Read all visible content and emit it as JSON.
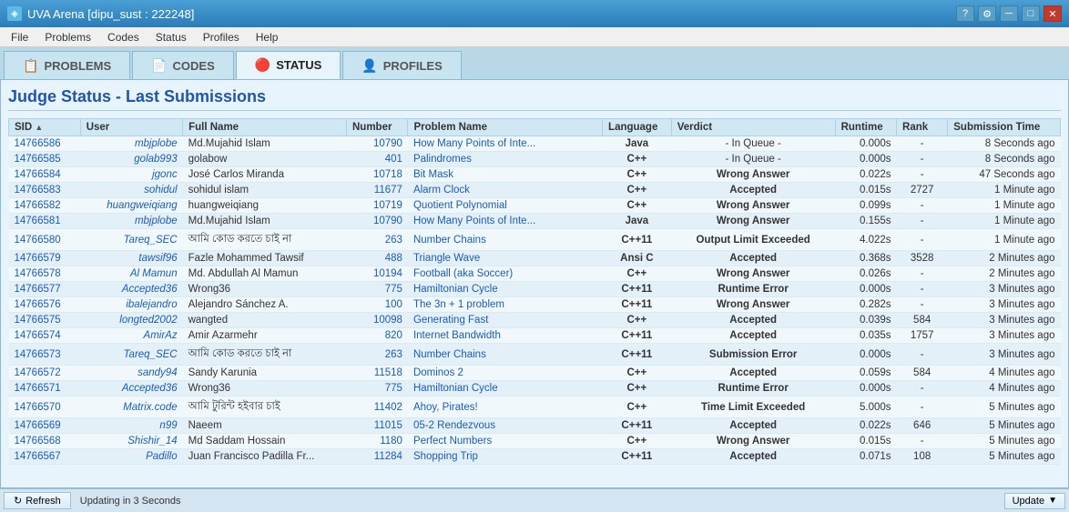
{
  "window": {
    "title": "UVA Arena [dipu_sust : 222248]"
  },
  "menu": {
    "items": [
      "File",
      "Problems",
      "Codes",
      "Status",
      "Profiles",
      "Help"
    ]
  },
  "tabs": [
    {
      "id": "problems",
      "label": "PROBLEMS",
      "icon": "📋",
      "active": false
    },
    {
      "id": "codes",
      "label": "CODES",
      "icon": "📄",
      "active": false
    },
    {
      "id": "status",
      "label": "STATUS",
      "icon": "🔴",
      "active": true
    },
    {
      "id": "profiles",
      "label": "PROFILES",
      "icon": "👤",
      "active": false
    }
  ],
  "page": {
    "title": "Judge Status - Last Submissions"
  },
  "table": {
    "columns": [
      "SID",
      "User",
      "Full Name",
      "Number",
      "Problem Name",
      "Language",
      "Verdict",
      "Runtime",
      "Rank",
      "Submission Time"
    ],
    "rows": [
      {
        "sid": "14766586",
        "user": "mbjplobe",
        "fullname": "Md.Mujahid Islam",
        "number": "10790",
        "problem": "How Many Points of Inte...",
        "lang": "Java",
        "langClass": "lang-java",
        "verdict": "- In Queue -",
        "verdictClass": "verdict-queue",
        "runtime": "0.000s",
        "rank": "-",
        "subtime": "8 Seconds ago"
      },
      {
        "sid": "14766585",
        "user": "golab993",
        "fullname": "golabow",
        "number": "401",
        "problem": "Palindromes",
        "lang": "C++",
        "langClass": "lang-cpp",
        "verdict": "- In Queue -",
        "verdictClass": "verdict-queue",
        "runtime": "0.000s",
        "rank": "-",
        "subtime": "8 Seconds ago"
      },
      {
        "sid": "14766584",
        "user": "jgonc",
        "fullname": "José Carlos Miranda",
        "number": "10718",
        "problem": "Bit Mask",
        "lang": "C++",
        "langClass": "lang-cpp",
        "verdict": "Wrong Answer",
        "verdictClass": "verdict-wrong",
        "runtime": "0.022s",
        "rank": "-",
        "subtime": "47 Seconds ago"
      },
      {
        "sid": "14766583",
        "user": "sohidul",
        "fullname": "sohidul islam",
        "number": "11677",
        "problem": "Alarm Clock",
        "lang": "C++",
        "langClass": "lang-cpp",
        "verdict": "Accepted",
        "verdictClass": "verdict-accepted",
        "runtime": "0.015s",
        "rank": "2727",
        "subtime": "1 Minute ago"
      },
      {
        "sid": "14766582",
        "user": "huangweiqiang",
        "fullname": "huangweiqiang",
        "number": "10719",
        "problem": "Quotient Polynomial",
        "lang": "C++",
        "langClass": "lang-cpp",
        "verdict": "Wrong Answer",
        "verdictClass": "verdict-wrong",
        "runtime": "0.099s",
        "rank": "-",
        "subtime": "1 Minute ago"
      },
      {
        "sid": "14766581",
        "user": "mbjplobe",
        "fullname": "Md.Mujahid Islam",
        "number": "10790",
        "problem": "How Many Points of Inte...",
        "lang": "Java",
        "langClass": "lang-java",
        "verdict": "Wrong Answer",
        "verdictClass": "verdict-wrong",
        "runtime": "0.155s",
        "rank": "-",
        "subtime": "1 Minute ago"
      },
      {
        "sid": "14766580",
        "user": "Tareq_SEC",
        "fullname": "আমি কোড করতে চাই না",
        "number": "263",
        "problem": "Number Chains",
        "lang": "C++11",
        "langClass": "lang-cpp11",
        "verdict": "Output Limit Exceeded",
        "verdictClass": "verdict-ole",
        "runtime": "4.022s",
        "rank": "-",
        "subtime": "1 Minute ago"
      },
      {
        "sid": "14766579",
        "user": "tawsif96",
        "fullname": "Fazle Mohammed Tawsif",
        "number": "488",
        "problem": "Triangle Wave",
        "lang": "Ansi C",
        "langClass": "lang-ansic",
        "verdict": "Accepted",
        "verdictClass": "verdict-accepted",
        "runtime": "0.368s",
        "rank": "3528",
        "subtime": "2 Minutes ago"
      },
      {
        "sid": "14766578",
        "user": "Al Mamun",
        "fullname": "Md. Abdullah Al Mamun",
        "number": "10194",
        "problem": "Football (aka Soccer)",
        "lang": "C++",
        "langClass": "lang-cpp",
        "verdict": "Wrong Answer",
        "verdictClass": "verdict-wrong",
        "runtime": "0.026s",
        "rank": "-",
        "subtime": "2 Minutes ago"
      },
      {
        "sid": "14766577",
        "user": "Accepted36",
        "fullname": "Wrong36",
        "number": "775",
        "problem": "Hamiltonian Cycle",
        "lang": "C++11",
        "langClass": "lang-cpp11",
        "verdict": "Runtime Error",
        "verdictClass": "verdict-re",
        "runtime": "0.000s",
        "rank": "-",
        "subtime": "3 Minutes ago"
      },
      {
        "sid": "14766576",
        "user": "ibalejandro",
        "fullname": "Alejandro Sánchez A.",
        "number": "100",
        "problem": "The 3n + 1 problem",
        "lang": "C++11",
        "langClass": "lang-cpp11",
        "verdict": "Wrong Answer",
        "verdictClass": "verdict-wrong",
        "runtime": "0.282s",
        "rank": "-",
        "subtime": "3 Minutes ago"
      },
      {
        "sid": "14766575",
        "user": "longted2002",
        "fullname": "wangted",
        "number": "10098",
        "problem": "Generating Fast",
        "lang": "C++",
        "langClass": "lang-cpp",
        "verdict": "Accepted",
        "verdictClass": "verdict-accepted",
        "runtime": "0.039s",
        "rank": "584",
        "subtime": "3 Minutes ago"
      },
      {
        "sid": "14766574",
        "user": "AmirAz",
        "fullname": "Amir Azarmehr",
        "number": "820",
        "problem": "Internet Bandwidth",
        "lang": "C++11",
        "langClass": "lang-cpp11",
        "verdict": "Accepted",
        "verdictClass": "verdict-accepted",
        "runtime": "0.035s",
        "rank": "1757",
        "subtime": "3 Minutes ago"
      },
      {
        "sid": "14766573",
        "user": "Tareq_SEC",
        "fullname": "আমি কোড করতে চাই না",
        "number": "263",
        "problem": "Number Chains",
        "lang": "C++11",
        "langClass": "lang-cpp11",
        "verdict": "Submission Error",
        "verdictClass": "verdict-se",
        "runtime": "0.000s",
        "rank": "-",
        "subtime": "3 Minutes ago"
      },
      {
        "sid": "14766572",
        "user": "sandy94",
        "fullname": "Sandy Karunia",
        "number": "11518",
        "problem": "Dominos 2",
        "lang": "C++",
        "langClass": "lang-cpp",
        "verdict": "Accepted",
        "verdictClass": "verdict-accepted",
        "runtime": "0.059s",
        "rank": "584",
        "subtime": "4 Minutes ago"
      },
      {
        "sid": "14766571",
        "user": "Accepted36",
        "fullname": "Wrong36",
        "number": "775",
        "problem": "Hamiltonian Cycle",
        "lang": "C++",
        "langClass": "lang-cpp",
        "verdict": "Runtime Error",
        "verdictClass": "verdict-re",
        "runtime": "0.000s",
        "rank": "-",
        "subtime": "4 Minutes ago"
      },
      {
        "sid": "14766570",
        "user": "Matrix.code",
        "fullname": "আমি টুরিন্ট হইবার চাই",
        "number": "11402",
        "problem": "Ahoy, Pirates!",
        "lang": "C++",
        "langClass": "lang-cpp",
        "verdict": "Time Limit Exceeded",
        "verdictClass": "verdict-tle",
        "runtime": "5.000s",
        "rank": "-",
        "subtime": "5 Minutes ago"
      },
      {
        "sid": "14766569",
        "user": "n99",
        "fullname": "Naeem",
        "number": "11015",
        "problem": "05-2 Rendezvous",
        "lang": "C++11",
        "langClass": "lang-cpp11",
        "verdict": "Accepted",
        "verdictClass": "verdict-accepted",
        "runtime": "0.022s",
        "rank": "646",
        "subtime": "5 Minutes ago"
      },
      {
        "sid": "14766568",
        "user": "Shishir_14",
        "fullname": "Md Saddam Hossain",
        "number": "1180",
        "problem": "Perfect Numbers",
        "lang": "C++",
        "langClass": "lang-cpp",
        "verdict": "Wrong Answer",
        "verdictClass": "verdict-wrong",
        "runtime": "0.015s",
        "rank": "-",
        "subtime": "5 Minutes ago"
      },
      {
        "sid": "14766567",
        "user": "Padillo",
        "fullname": "Juan Francisco Padilla Fr...",
        "number": "11284",
        "problem": "Shopping Trip",
        "lang": "C++11",
        "langClass": "lang-cpp11",
        "verdict": "Accepted",
        "verdictClass": "verdict-accepted",
        "runtime": "0.071s",
        "rank": "108",
        "subtime": "5 Minutes ago"
      }
    ]
  },
  "statusbar": {
    "refresh_label": "Refresh",
    "updating_text": "Updating in 3 Seconds",
    "update_label": "Update"
  }
}
